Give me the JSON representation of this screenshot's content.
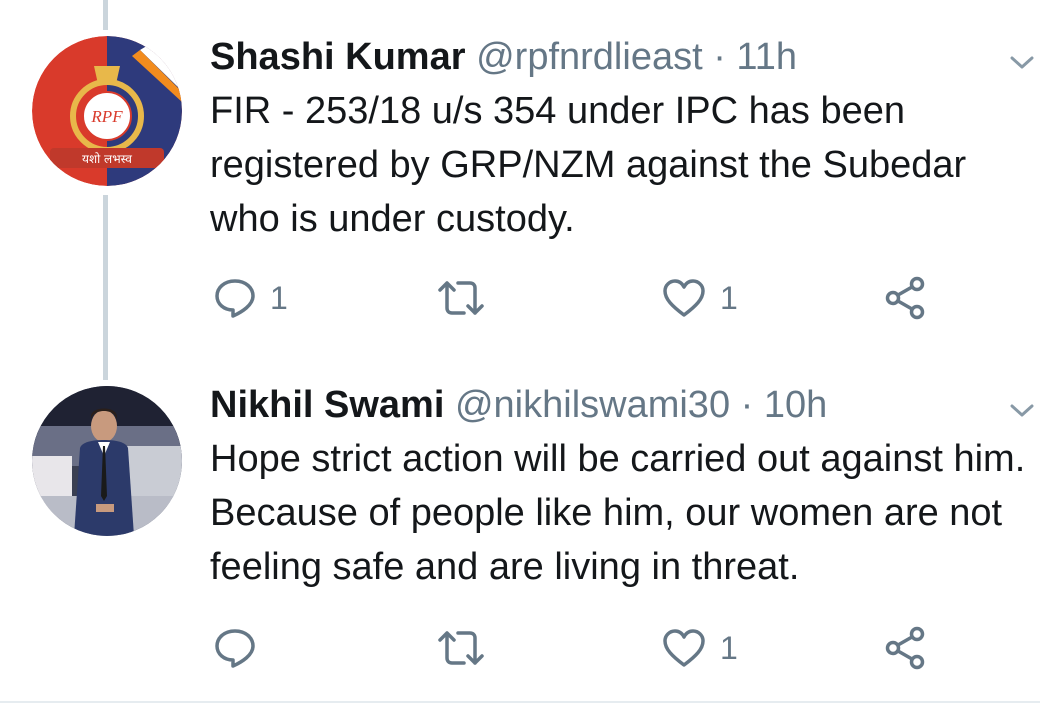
{
  "tweets": [
    {
      "name": "Shashi Kumar",
      "handle": "@rpfnrdlieast",
      "time": "· 11h",
      "text": "FIR - 253/18 u/s 354 under  IPC has been registered by GRP/NZM against the Subedar who is under custody.",
      "avatar_text": "RPF",
      "avatar_banner": "यशो लभस्व",
      "reply_count": "1",
      "retweet_count": "",
      "like_count": "1"
    },
    {
      "name": "Nikhil Swami",
      "handle": "@nikhilswami30",
      "time": "· 10h",
      "text": "Hope strict action will be carried out against him. Because of people like him, our women are not feeling safe and are living in threat.",
      "reply_count": "",
      "retweet_count": "",
      "like_count": "1"
    }
  ],
  "colors": {
    "text": "#14171a",
    "secondary": "#657786",
    "thread_line": "#cbd5dc"
  }
}
